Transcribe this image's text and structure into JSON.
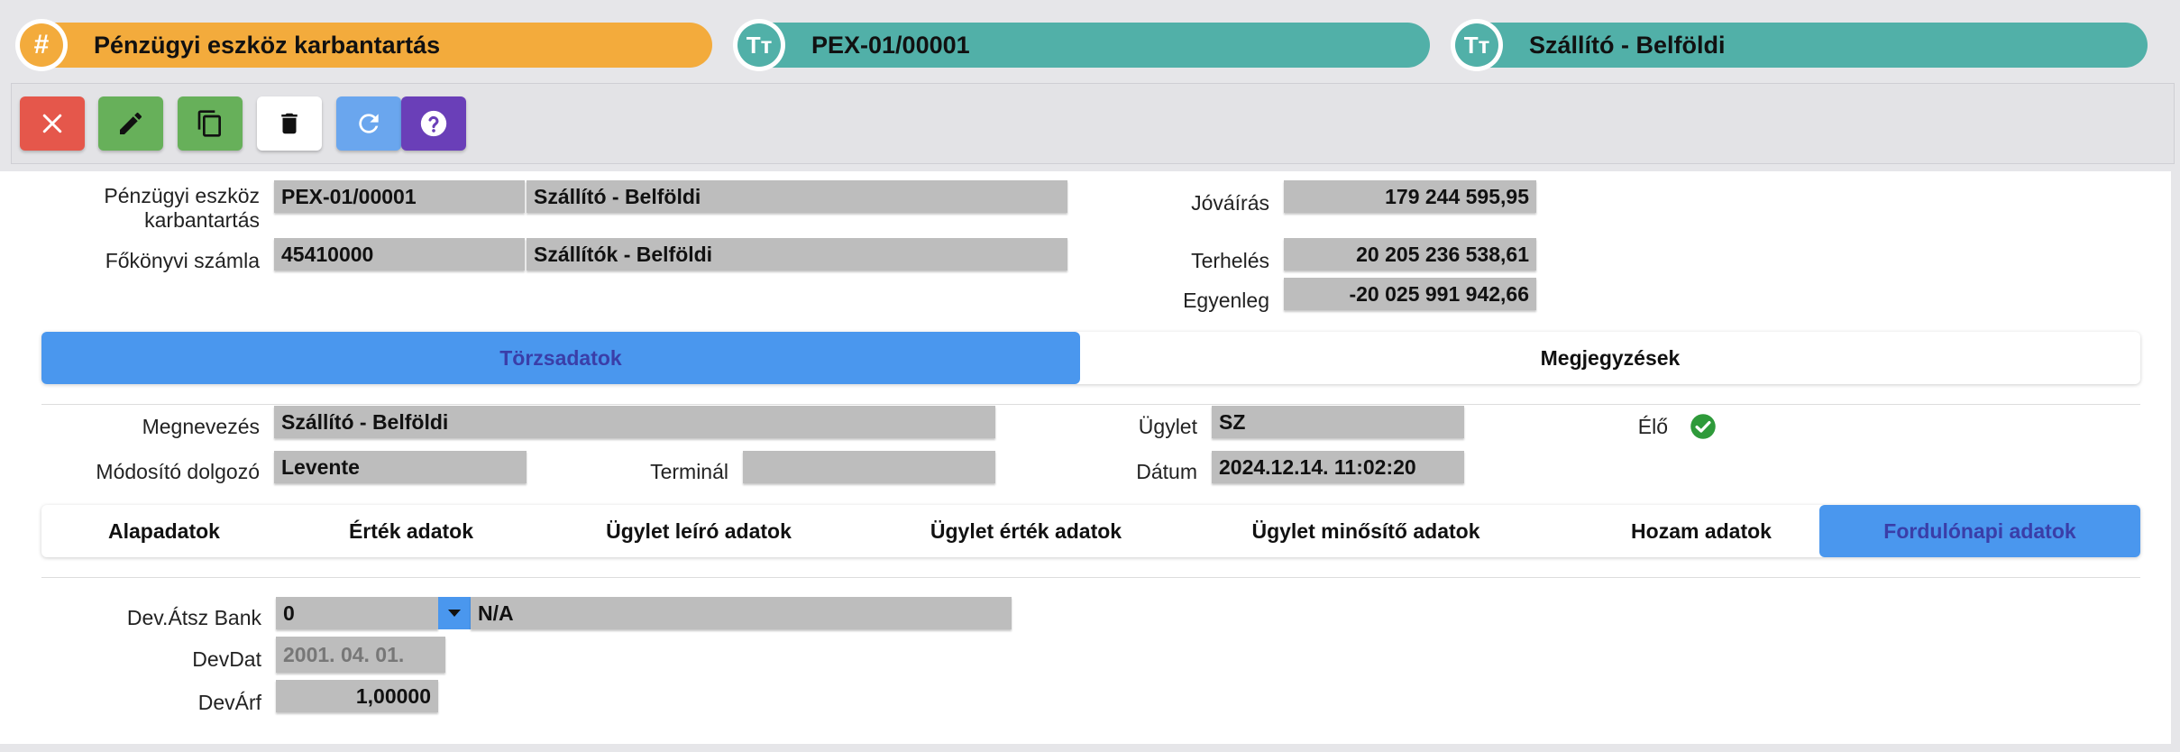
{
  "header": {
    "pill1": {
      "icon": "hash-icon",
      "glyph": "#",
      "text": "Pénzügyi eszköz karbantartás"
    },
    "pill2": {
      "icon": "text-type-icon",
      "glyph": "Tт",
      "text": "PEX-01/00001"
    },
    "pill3": {
      "icon": "text-type-icon",
      "glyph": "Tт",
      "text": "Szállító - Belföldi"
    }
  },
  "toolbar": {
    "buttons": [
      {
        "name": "close-button",
        "icon": "close-icon",
        "color": "#e5574b"
      },
      {
        "name": "edit-button",
        "icon": "pencil-icon",
        "color": "#67b05a"
      },
      {
        "name": "copy-button",
        "icon": "copy-icon",
        "color": "#67b05a"
      },
      {
        "name": "delete-button",
        "icon": "trash-icon",
        "color": "#ffffff"
      },
      {
        "name": "refresh-button",
        "icon": "refresh-icon",
        "color": "#6aa6ee"
      },
      {
        "name": "help-button",
        "icon": "help-icon",
        "color": "#6a3fb8"
      }
    ]
  },
  "form": {
    "asset_label": "Pénzügyi eszköz karbantartás",
    "asset_code": "PEX-01/00001",
    "asset_name": "Szállító - Belföldi",
    "ledger_label": "Főkönyvi számla",
    "ledger_code": "45410000",
    "ledger_name": "Szállítók - Belföldi",
    "credit_label": "Jóváírás",
    "credit_value": "179 244 595,95",
    "debit_label": "Terhelés",
    "debit_value": "20 205 236 538,61",
    "balance_label": "Egyenleg",
    "balance_value": "-20 025 991 942,66"
  },
  "main_tabs": {
    "items": [
      "Törzsadatok",
      "Megjegyzések"
    ],
    "active": 0
  },
  "details": {
    "name_label": "Megnevezés",
    "name_value": "Szállító - Belföldi",
    "deal_label": "Ügylet",
    "deal_value": "SZ",
    "alive_label": "Élő",
    "modifier_label": "Módosító dolgozó",
    "modifier_value": "Levente",
    "terminal_label": "Terminál",
    "terminal_value": "",
    "date_label": "Dátum",
    "date_value": "2024.12.14. 11:02:20"
  },
  "sub_tabs": {
    "items": [
      "Alapadatok",
      "Érték adatok",
      "Ügylet leíró adatok",
      "Ügylet érték adatok",
      "Ügylet minősítő adatok",
      "Hozam adatok",
      "Fordulónapi adatok"
    ],
    "active": 6
  },
  "turnday": {
    "bank_label": "Dev.Átsz Bank",
    "bank_code": "0",
    "bank_name": "N/A",
    "devdat_label": "DevDat",
    "devdat_value": "2001. 04. 01.",
    "devarf_label": "DevÁrf",
    "devarf_value": "1,00000"
  },
  "colors": {
    "orange": "#f3ab3c",
    "teal": "#51b0a8",
    "active_tab": "#4a97ee",
    "check": "#2e9a3a"
  }
}
